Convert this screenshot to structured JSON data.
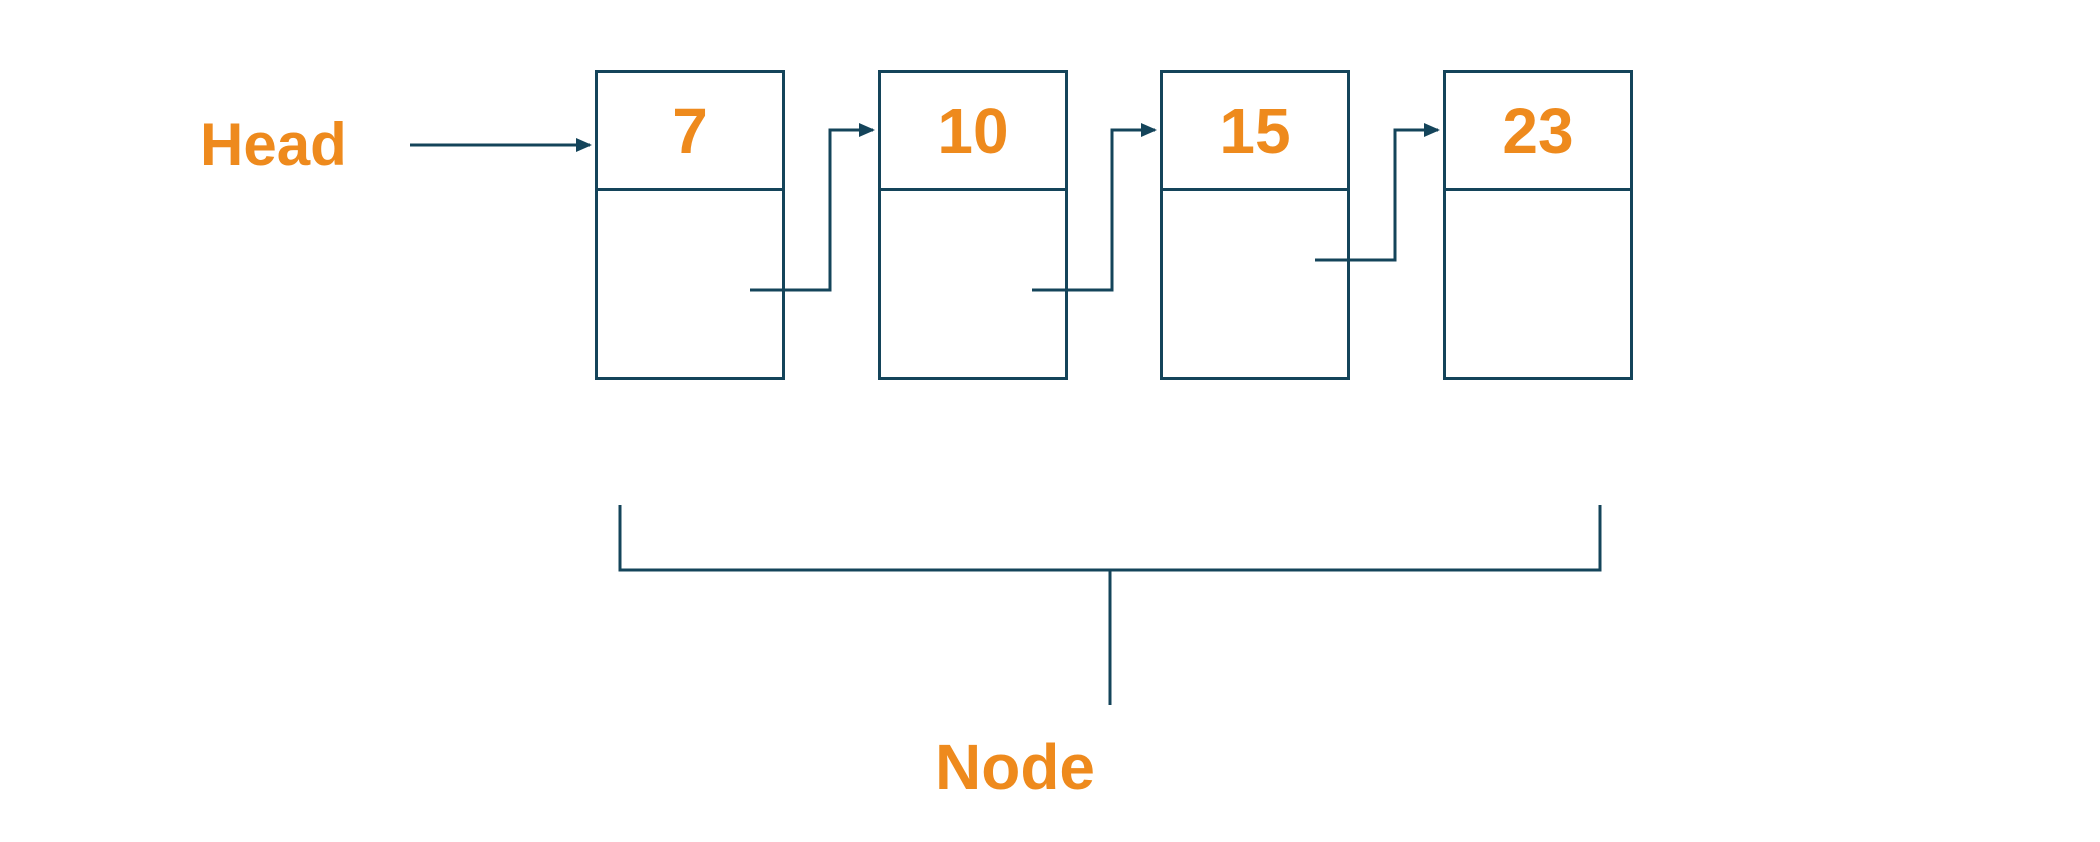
{
  "labels": {
    "head": "Head",
    "node": "Node"
  },
  "nodes": [
    {
      "value": "7"
    },
    {
      "value": "10"
    },
    {
      "value": "15"
    },
    {
      "value": "23"
    }
  ],
  "colors": {
    "accent": "#ee8a1d",
    "line": "#14445a"
  }
}
